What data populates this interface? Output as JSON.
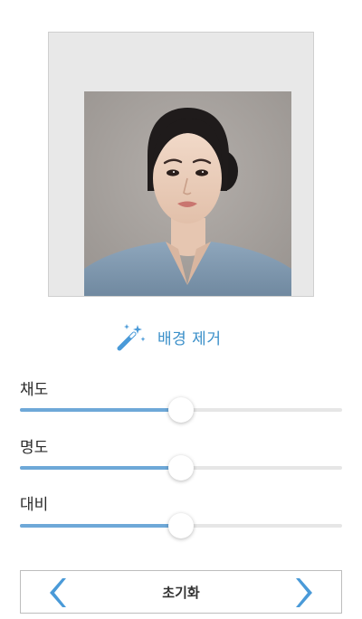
{
  "photo": {
    "frame_color": "#e8e8e8",
    "backdrop_color": "#a8a39f",
    "shirt_color": "#7f98b0"
  },
  "background_removal": {
    "label": "배경 제거",
    "icon": "magic-wand-icon",
    "color": "#3a8fc9"
  },
  "adjustments": {
    "saturation": {
      "label": "채도",
      "value_percent": 50
    },
    "brightness": {
      "label": "명도",
      "value_percent": 50
    },
    "contrast": {
      "label": "대비",
      "value_percent": 50
    }
  },
  "slider_colors": {
    "fill": "#6ea8d8",
    "track": "#e6e6e6"
  },
  "navigation": {
    "prev_icon": "chevron-left-icon",
    "next_icon": "chevron-right-icon",
    "reset_label": "초기화",
    "arrow_color": "#4a9ad8"
  }
}
